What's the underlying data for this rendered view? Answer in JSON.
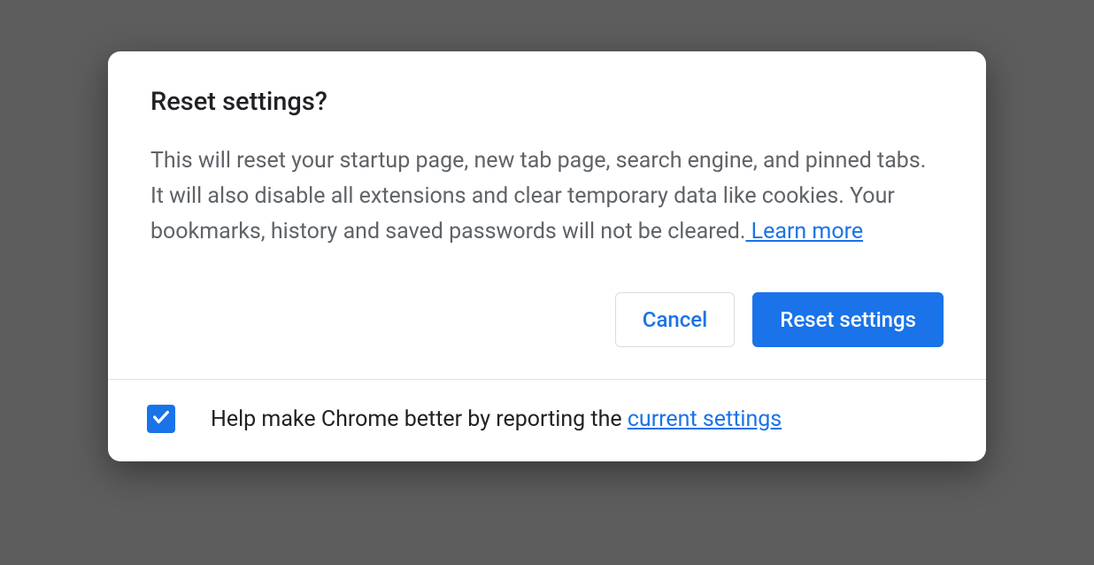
{
  "dialog": {
    "title": "Reset settings?",
    "body_text": "This will reset your startup page, new tab page, search engine, and pinned tabs. It will also disable all extensions and clear temporary data like cookies. Your bookmarks, history and saved passwords will not be cleared.",
    "learn_more_label": " Learn more",
    "buttons": {
      "cancel": "Cancel",
      "confirm": "Reset settings"
    },
    "footer": {
      "checkbox_checked": true,
      "help_text": "Help make Chrome better by reporting the ",
      "current_settings_label": "current settings"
    }
  }
}
